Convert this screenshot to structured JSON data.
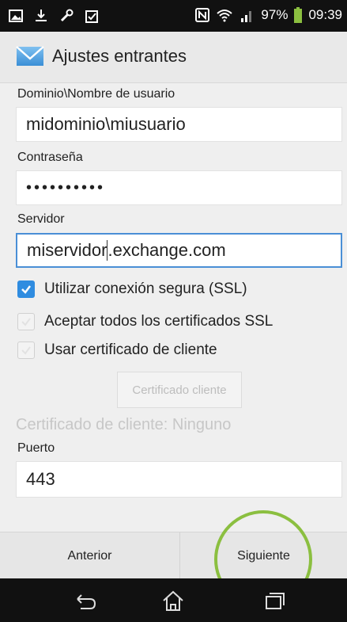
{
  "status_bar": {
    "battery": "97%",
    "time": "09:39",
    "left_icons": [
      "image-icon",
      "download-icon",
      "wrench-icon",
      "clipboard-check-icon"
    ],
    "right_icons": [
      "nfc-icon",
      "wifi-icon",
      "signal-icon",
      "battery-icon"
    ]
  },
  "app_bar": {
    "title": "Ajustes entrantes",
    "icon": "mail-icon"
  },
  "form": {
    "domain_label": "Dominio\\Nombre de usuario",
    "domain_value": "midominio\\miusuario",
    "password_label": "Contraseña",
    "password_value": "••••••••••",
    "server_label": "Servidor",
    "server_value_before_cursor": "miservidor",
    "server_value_after_cursor": ".exchange.com",
    "ssl_label": "Utilizar conexión segura (SSL)",
    "ssl_checked": true,
    "accept_all_label": "Aceptar todos los certificados SSL",
    "accept_all_checked": false,
    "client_cert_label": "Usar certificado de cliente",
    "client_cert_checked": false,
    "cert_button_label": "Certificado cliente",
    "cert_status": "Certificado de cliente: Ninguno",
    "port_label": "Puerto",
    "port_value": "443"
  },
  "buttons": {
    "previous": "Anterior",
    "next": "Siguiente"
  },
  "colors": {
    "accent": "#2f8ce0",
    "highlight_circle": "#8bbf40",
    "focus_border": "#4a8fd6"
  },
  "nav_bar": {
    "icons": [
      "back-icon",
      "home-icon",
      "recents-icon"
    ]
  }
}
